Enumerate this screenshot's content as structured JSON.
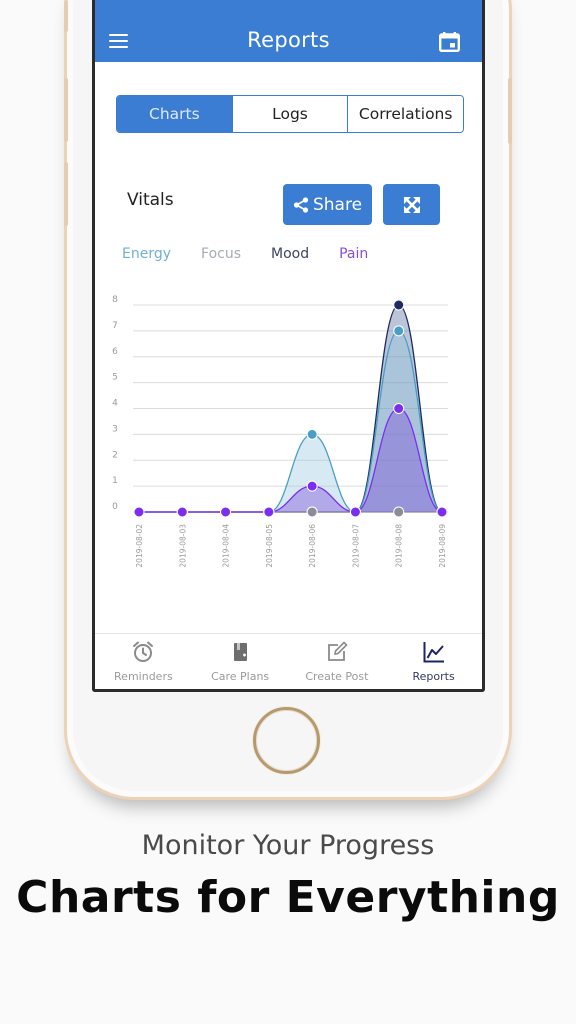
{
  "header": {
    "title": "Reports",
    "menu_icon": "hamburger-menu-icon",
    "calendar_icon": "calendar-icon"
  },
  "tabs": [
    {
      "label": "Charts",
      "active": true
    },
    {
      "label": "Logs",
      "active": false
    },
    {
      "label": "Correlations",
      "active": false
    }
  ],
  "section": {
    "title": "Vitals",
    "share_label": "Share",
    "share_icon": "share-icon",
    "expand_icon": "expand-arrows-icon"
  },
  "colors": {
    "brand": "#3a7dd3",
    "energy": "#4a9ec4",
    "focus": "#8c8c99",
    "mood": "#1d2a66",
    "pain": "#7a2ef0"
  },
  "chart_data": {
    "type": "area",
    "title": "Vitals",
    "x": [
      "2019-08-02",
      "2019-08-03",
      "2019-08-04",
      "2019-08-05",
      "2019-08-06",
      "2019-08-07",
      "2019-08-08",
      "2019-08-09"
    ],
    "yticks": [
      "0",
      "1",
      "2",
      "3",
      "4",
      "5",
      "6",
      "7",
      "8"
    ],
    "ylim": [
      0,
      8
    ],
    "grid": true,
    "legend_position": "top-left",
    "series": [
      {
        "name": "Energy",
        "values": [
          0,
          0,
          0,
          0,
          3,
          0,
          7,
          0
        ],
        "color": "#4a9ec4",
        "fill": "rgba(140,195,222,0.35)"
      },
      {
        "name": "Focus",
        "values": [
          0,
          0,
          0,
          0,
          0,
          0,
          0,
          0
        ],
        "color": "#8c8c99",
        "fill": "rgba(140,140,153,0.3)"
      },
      {
        "name": "Mood",
        "values": [
          0,
          0,
          0,
          0,
          0,
          0,
          8,
          0
        ],
        "color": "#1d2a66",
        "fill": "rgba(60,90,140,0.35)"
      },
      {
        "name": "Pain",
        "values": [
          0,
          0,
          0,
          0,
          1,
          0,
          4,
          0
        ],
        "color": "#7a2ef0",
        "fill": "rgba(130,90,220,0.45)"
      }
    ]
  },
  "bottom_nav": [
    {
      "label": "Reminders",
      "icon": "alarm-clock-icon",
      "active": false
    },
    {
      "label": "Care Plans",
      "icon": "care-plan-book-icon",
      "active": false
    },
    {
      "label": "Create Post",
      "icon": "edit-post-icon",
      "active": false
    },
    {
      "label": "Reports",
      "icon": "line-chart-icon",
      "active": true
    }
  ],
  "promo": {
    "tagline": "Monitor Your Progress",
    "headline": "Charts for Everything"
  }
}
